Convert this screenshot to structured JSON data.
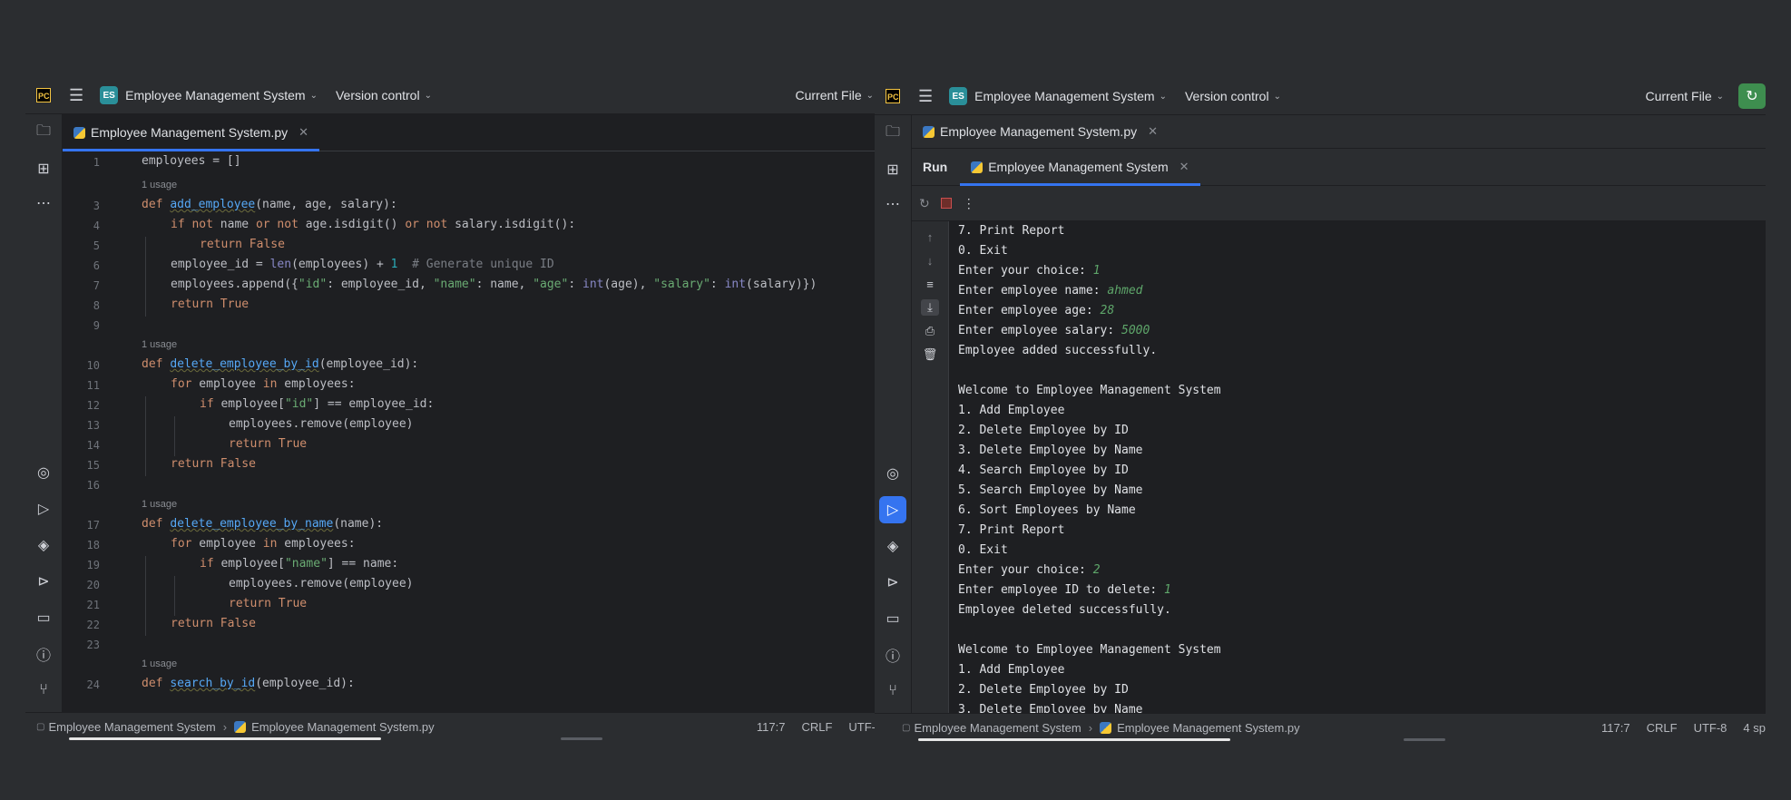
{
  "left": {
    "titlebar": {
      "logo": "PC",
      "project_badge": "ES",
      "project": "Employee Management System",
      "vcs": "Version control",
      "run_config": "Current File"
    },
    "tab": {
      "label": "Employee Management System.py"
    },
    "gutter": [
      "1",
      "3",
      "4",
      "5",
      "6",
      "7",
      "8",
      "9",
      "10",
      "11",
      "12",
      "13",
      "14",
      "15",
      "16",
      "17",
      "18",
      "19",
      "20",
      "21",
      "22",
      "23",
      "24"
    ],
    "usage_hint": "1 usage",
    "status": {
      "crumb_project": "Employee Management System",
      "crumb_file": "Employee Management System.py",
      "position": "117:7",
      "eol": "CRLF",
      "encoding": "UTF-"
    }
  },
  "right": {
    "titlebar": {
      "logo": "PC",
      "project_badge": "ES",
      "project": "Employee Management System",
      "vcs": "Version control",
      "run_config": "Current File"
    },
    "tab": {
      "label": "Employee Management System.py"
    },
    "run": {
      "label": "Run",
      "tab_label": "Employee Management System"
    },
    "console": [
      {
        "text": "7. Print Report"
      },
      {
        "text": "0. Exit"
      },
      {
        "text": "Enter your choice: ",
        "input": "1"
      },
      {
        "text": "Enter employee name: ",
        "input": "ahmed"
      },
      {
        "text": "Enter employee age: ",
        "input": "28"
      },
      {
        "text": "Enter employee salary: ",
        "input": "5000"
      },
      {
        "text": "Employee added successfully."
      },
      {
        "text": ""
      },
      {
        "text": "Welcome to Employee Management System"
      },
      {
        "text": "1. Add Employee"
      },
      {
        "text": "2. Delete Employee by ID"
      },
      {
        "text": "3. Delete Employee by Name"
      },
      {
        "text": "4. Search Employee by ID"
      },
      {
        "text": "5. Search Employee by Name"
      },
      {
        "text": "6. Sort Employees by Name"
      },
      {
        "text": "7. Print Report"
      },
      {
        "text": "0. Exit"
      },
      {
        "text": "Enter your choice: ",
        "input": "2"
      },
      {
        "text": "Enter employee ID to delete: ",
        "input": "1"
      },
      {
        "text": "Employee deleted successfully."
      },
      {
        "text": ""
      },
      {
        "text": "Welcome to Employee Management System"
      },
      {
        "text": "1. Add Employee"
      },
      {
        "text": "2. Delete Employee by ID"
      },
      {
        "text": "3. Delete Employee by Name"
      }
    ],
    "status": {
      "crumb_project": "Employee Management System",
      "crumb_file": "Employee Management System.py",
      "position": "117:7",
      "eol": "CRLF",
      "encoding": "UTF-8",
      "indent": "4 sp"
    }
  },
  "code": {
    "l1": [
      "employees = []"
    ],
    "l3": [
      "def",
      "add_employee",
      "(name, age, salary):"
    ],
    "l4": [
      "if not",
      " name ",
      "or not",
      " age.isdigit() ",
      "or not",
      " salary.isdigit():"
    ],
    "l5": [
      "return False"
    ],
    "l6": [
      "employee_id = ",
      "len",
      "(employees) + ",
      "1",
      "  # Generate unique ID"
    ],
    "l7": [
      "employees.append({",
      "\"id\"",
      ": employee_id, ",
      "\"name\"",
      ": name, ",
      "\"age\"",
      ": ",
      "int",
      "(age), ",
      "\"salary\"",
      ": ",
      "int",
      "(salary)})"
    ],
    "l8": [
      "return True"
    ],
    "l10": [
      "def",
      "delete_employee_by_id",
      "(employee_id):"
    ],
    "l11": [
      "for",
      " employee ",
      "in",
      " employees:"
    ],
    "l12": [
      "if",
      " employee[",
      "\"id\"",
      "] == employee_id:"
    ],
    "l13": [
      "employees.remove(employee)"
    ],
    "l14": [
      "return True"
    ],
    "l15": [
      "return False"
    ],
    "l17": [
      "def",
      "delete_employee_by_name",
      "(name):"
    ],
    "l18": [
      "for",
      " employee ",
      "in",
      " employees:"
    ],
    "l19": [
      "if",
      " employee[",
      "\"name\"",
      "] == name:"
    ],
    "l20": [
      "employees.remove(employee)"
    ],
    "l21": [
      "return True"
    ],
    "l22": [
      "return False"
    ],
    "l24": [
      "def",
      "search_by_id",
      "(employee_id):"
    ]
  }
}
